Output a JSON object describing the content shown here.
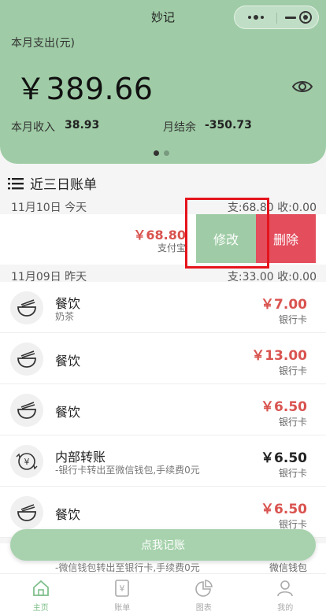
{
  "header": {
    "app_title": "妙记",
    "month_expense_label": "本月支出(元)",
    "month_expense_amount": "￥389.66",
    "income_label": "本月收入",
    "income_value": "38.93",
    "balance_label": "月结余",
    "balance_value": "-350.73",
    "accent_color": "#9fcca6"
  },
  "section": {
    "title": "近三日账单"
  },
  "days": [
    {
      "date": "11月10日 今天",
      "summary": "支:68.80 收:0.00"
    },
    {
      "date": "11月09日 昨天",
      "summary": "支:33.00 收:0.00"
    }
  ],
  "swiped": {
    "amount": "￥68.80",
    "account": "支付宝",
    "edit_label": "修改",
    "delete_label": "删除"
  },
  "items": [
    {
      "title": "餐饮",
      "sub": "奶茶",
      "amount": "￥7.00",
      "account": "银行卡",
      "type": "expense",
      "icon": "bowl-icon"
    },
    {
      "title": "餐饮",
      "sub": "",
      "amount": "￥13.00",
      "account": "银行卡",
      "type": "expense",
      "icon": "bowl-icon"
    },
    {
      "title": "餐饮",
      "sub": "",
      "amount": "￥6.50",
      "account": "银行卡",
      "type": "expense",
      "icon": "bowl-icon"
    },
    {
      "title": "内部转账",
      "sub": "-银行卡转出至微信钱包,手续费0元",
      "amount": "￥6.50",
      "account": "银行卡",
      "type": "transfer",
      "icon": "transfer-icon"
    },
    {
      "title": "餐饮",
      "sub": "",
      "amount": "￥6.50",
      "account": "银行卡",
      "type": "expense",
      "icon": "bowl-icon"
    }
  ],
  "peek": {
    "sub": "-微信钱包转出至银行卡,手续费0元",
    "account": "微信钱包"
  },
  "record_button": "点我记账",
  "tabs": [
    {
      "label": "主页",
      "icon": "home-icon",
      "active": true
    },
    {
      "label": "账单",
      "icon": "bill-icon",
      "active": false
    },
    {
      "label": "图表",
      "icon": "chart-icon",
      "active": false
    },
    {
      "label": "我的",
      "icon": "user-icon",
      "active": false
    }
  ]
}
